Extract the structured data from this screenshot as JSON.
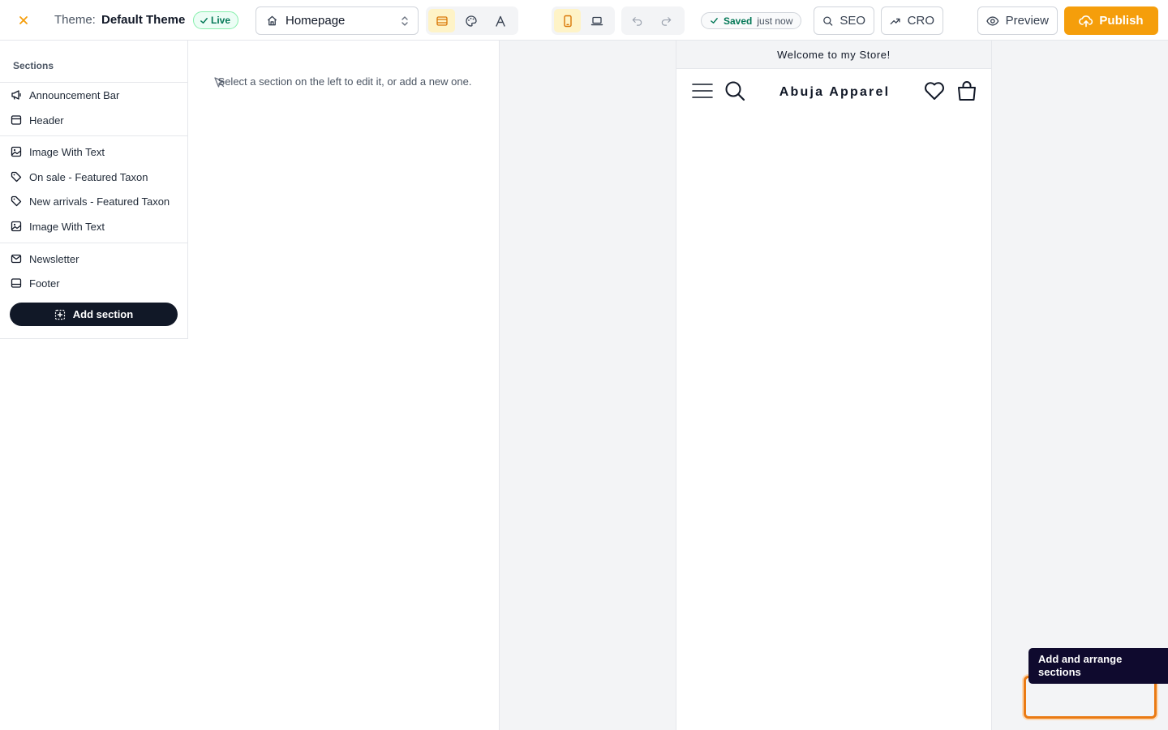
{
  "header": {
    "theme_label": "Theme:",
    "theme_name": "Default Theme",
    "live_badge": "Live",
    "page_select": "Homepage",
    "saved_status": "Saved",
    "saved_time": "just now",
    "seo_label": "SEO",
    "cro_label": "CRO",
    "preview_label": "Preview",
    "publish_label": "Publish"
  },
  "sidebar": {
    "title": "Sections",
    "items": [
      {
        "label": "Announcement Bar",
        "icon": "megaphone-icon"
      },
      {
        "label": "Header",
        "icon": "layout-header-icon"
      },
      {
        "label": "Image With Text",
        "icon": "image-icon"
      },
      {
        "label": "On sale - Featured Taxon",
        "icon": "tag-icon"
      },
      {
        "label": "New arrivals - Featured Taxon",
        "icon": "tag-icon"
      },
      {
        "label": "Image With Text",
        "icon": "image-icon"
      },
      {
        "label": "Newsletter",
        "icon": "mail-icon"
      },
      {
        "label": "Footer",
        "icon": "layout-footer-icon"
      }
    ],
    "add_section_label": "Add section"
  },
  "editor": {
    "hint": "Select a section on the left to edit it, or add a new one."
  },
  "preview": {
    "announcement": "Welcome to my Store!",
    "store_name": "Abuja Apparel"
  },
  "tooltip": {
    "text": "Add and arrange sections"
  },
  "colors": {
    "accent": "#f59e0b",
    "dark": "#111827",
    "live_green": "#047857",
    "tooltip_bg": "#0f0a2e",
    "highlight": "#ea7a13"
  }
}
